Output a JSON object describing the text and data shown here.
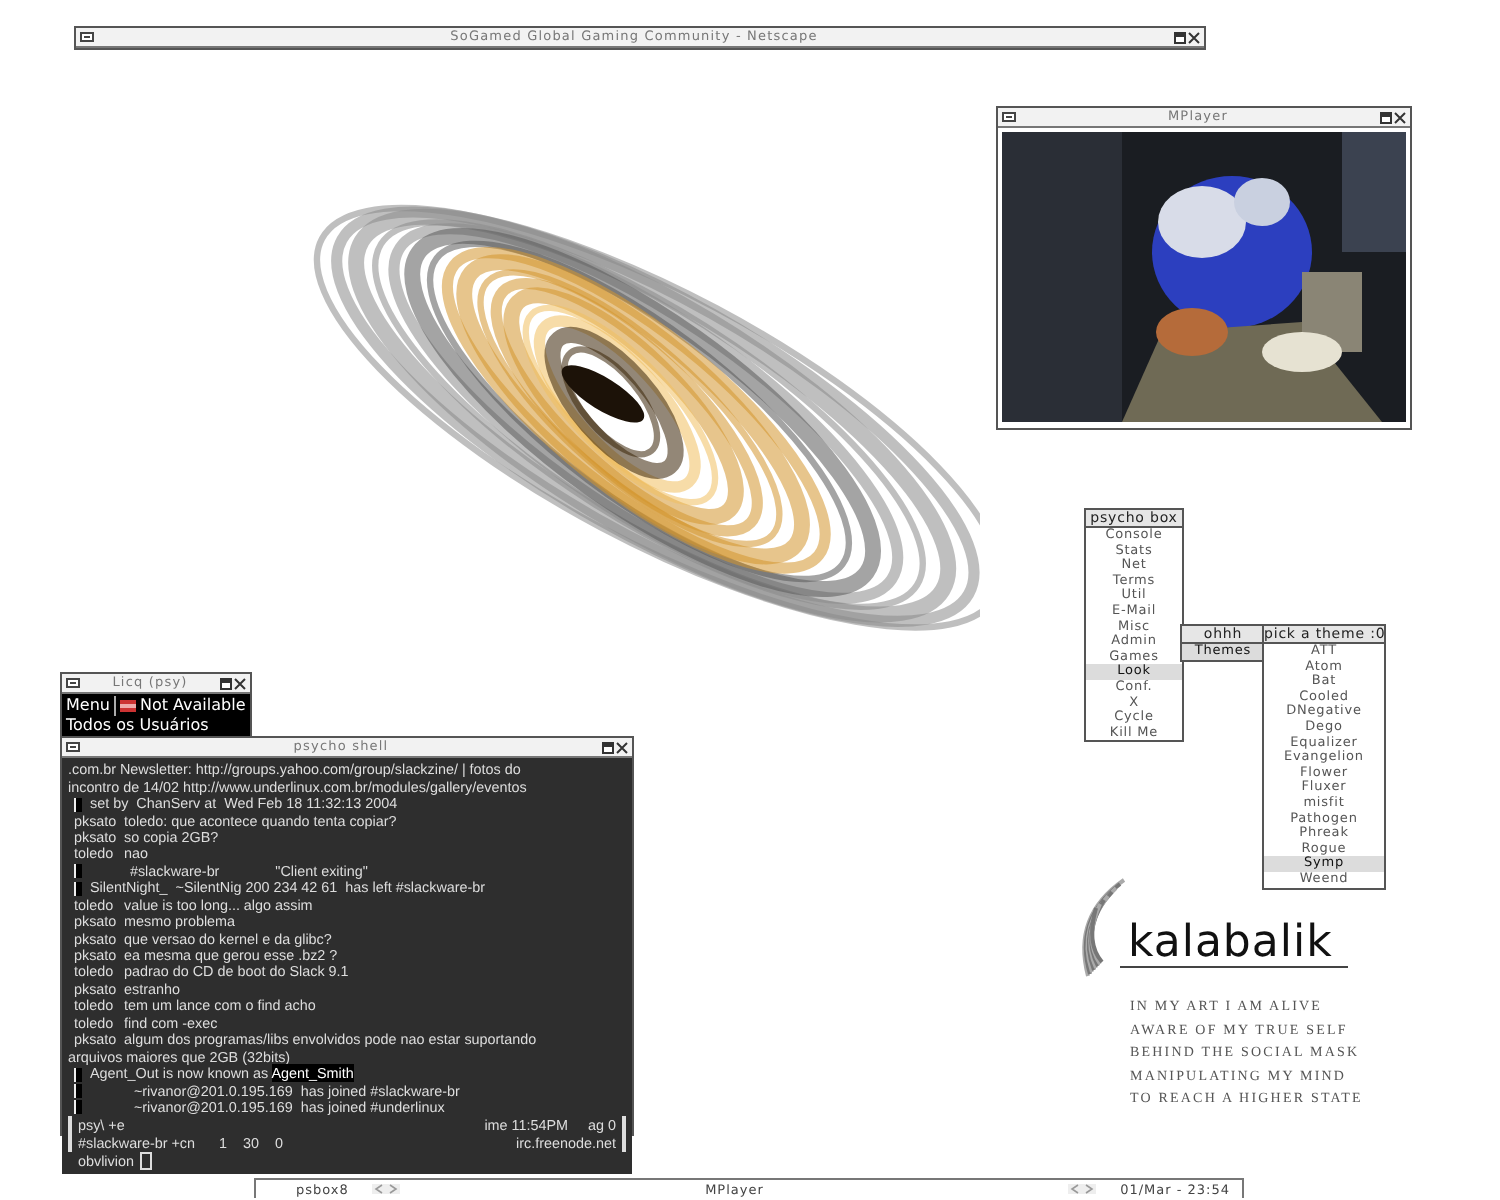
{
  "browser_window": {
    "title": "SoGamed Global Gaming Community - Netscape"
  },
  "mplayer_window": {
    "title": "MPlayer"
  },
  "menu": {
    "title": "psycho box",
    "items": [
      {
        "label": "Console",
        "selected": false
      },
      {
        "label": "Stats",
        "selected": false
      },
      {
        "label": "Net",
        "selected": false
      },
      {
        "label": "Terms",
        "selected": false
      },
      {
        "label": "Util",
        "selected": false
      },
      {
        "label": "E-Mail",
        "selected": false
      },
      {
        "label": "Misc",
        "selected": false
      },
      {
        "label": "Admin",
        "selected": false
      },
      {
        "label": "Games",
        "selected": false
      },
      {
        "label": "Look",
        "selected": true
      },
      {
        "label": "Conf.",
        "selected": false
      },
      {
        "label": "X",
        "selected": false
      },
      {
        "label": "Cycle",
        "selected": false
      },
      {
        "label": "Kill Me",
        "selected": false
      }
    ]
  },
  "submenu": {
    "title": "ohhh",
    "items": [
      {
        "label": "Themes",
        "selected": true
      }
    ]
  },
  "theme_menu": {
    "title": "pick a theme :0",
    "items": [
      {
        "label": "ATT",
        "selected": false
      },
      {
        "label": "Atom",
        "selected": false
      },
      {
        "label": "Bat",
        "selected": false
      },
      {
        "label": "Cooled",
        "selected": false
      },
      {
        "label": "DNegative",
        "selected": false
      },
      {
        "label": "Dego",
        "selected": false
      },
      {
        "label": "Equalizer",
        "selected": false
      },
      {
        "label": "Evangelion",
        "selected": false
      },
      {
        "label": "Flower",
        "selected": false
      },
      {
        "label": "Fluxer",
        "selected": false
      },
      {
        "label": "misfit",
        "selected": false
      },
      {
        "label": "Pathogen",
        "selected": false
      },
      {
        "label": "Phreak",
        "selected": false
      },
      {
        "label": "Rogue",
        "selected": false
      },
      {
        "label": "Symp",
        "selected": true
      },
      {
        "label": "Weend",
        "selected": false
      }
    ]
  },
  "licq_window": {
    "title": "Licq (psy)",
    "menu_label": "Menu",
    "status": "Not Available",
    "group": "Todos os Usuários"
  },
  "shell_window": {
    "title": "psycho shell",
    "lines": [
      {
        "kind": "plain",
        "text": ".com.br Newsletter: http://groups.yahoo.com/group/slackzine/ | fotos do"
      },
      {
        "kind": "plain",
        "text": "incontro de 14/02 http://www.underlinux.com.br/modules/gallery/eventos"
      },
      {
        "kind": "event",
        "text": "set by  ChanServ at  Wed Feb 18 11:32:13 2004"
      },
      {
        "kind": "msg",
        "nick": "pksato",
        "text": "toledo: que acontece quando tenta copiar?"
      },
      {
        "kind": "msg",
        "nick": "pksato",
        "text": "so copia 2GB?"
      },
      {
        "kind": "msg",
        "nick": "toledo",
        "text": "nao"
      },
      {
        "kind": "event",
        "text": "          #slackware-br              \"Client exiting\""
      },
      {
        "kind": "event",
        "text": "SilentNight_  ~SilentNig 200 234 42 61  has left #slackware-br"
      },
      {
        "kind": "msg",
        "nick": "toledo",
        "text": "value is too long... algo assim"
      },
      {
        "kind": "msg",
        "nick": "pksato",
        "text": "mesmo problema"
      },
      {
        "kind": "msg",
        "nick": "pksato",
        "text": "que versao do kernel e da glibc?"
      },
      {
        "kind": "msg",
        "nick": "pksato",
        "text": "ea mesma que gerou esse .bz2 ?"
      },
      {
        "kind": "msg",
        "nick": "toledo",
        "text": "padrao do CD de boot do Slack 9.1"
      },
      {
        "kind": "msg",
        "nick": "pksato",
        "text": "estranho"
      },
      {
        "kind": "msg",
        "nick": "toledo",
        "text": "tem um lance com o find acho"
      },
      {
        "kind": "msg",
        "nick": "toledo",
        "text": "find com -exec"
      },
      {
        "kind": "msg",
        "nick": "pksato",
        "text": "algum dos programas/libs envolvidos pode nao estar suportando"
      },
      {
        "kind": "plain",
        "text": "arquivos maiores que 2GB (32bits)"
      },
      {
        "kind": "event",
        "text": "Agent_Out is now known as ",
        "highlight": "Agent_Smith"
      },
      {
        "kind": "event",
        "text": "           ~rivanor@201.0.195.169  has joined #slackware-br"
      },
      {
        "kind": "event",
        "text": "           ~rivanor@201.0.195.169  has joined #underlinux"
      }
    ],
    "status": [
      {
        "left": "psy\\ +e",
        "right": "ime 11:54PM     ag 0"
      },
      {
        "left": "#slackware-br +cn      1    30    0",
        "right": "irc.freenode.net"
      }
    ],
    "input": "obvlivion"
  },
  "logo": {
    "name": "kalabalik",
    "poem": [
      "IN MY ART I AM ALIVE",
      "AWARE OF MY TRUE SELF",
      "BEHIND THE SOCIAL MASK",
      "MANIPULATING MY MIND",
      "TO REACH A HIGHER STATE"
    ]
  },
  "taskbar": {
    "left": "psbox8",
    "center": "MPlayer",
    "clock": "01/Mar - 23:54"
  }
}
